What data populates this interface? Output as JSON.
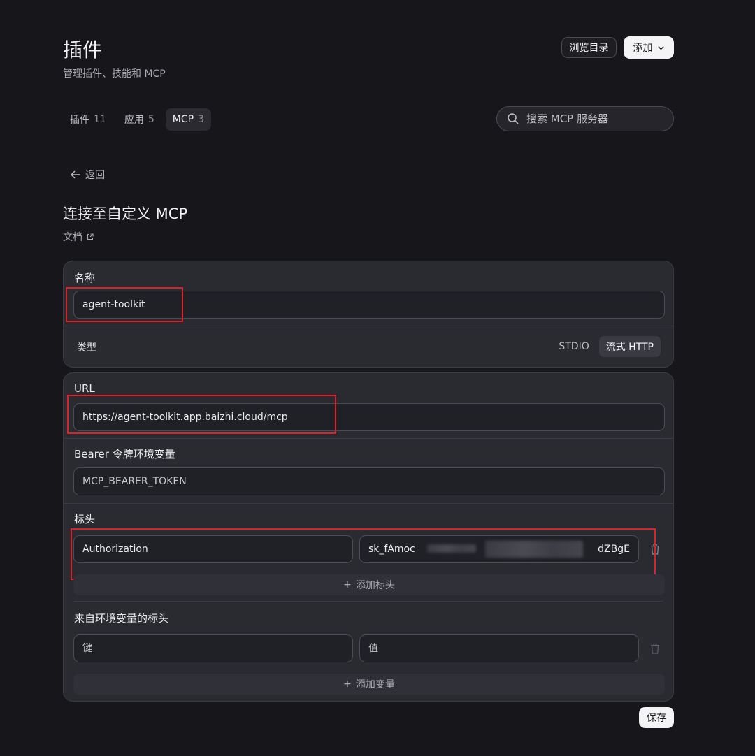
{
  "header": {
    "title": "插件",
    "subtitle": "管理插件、技能和 MCP",
    "browse_label": "浏览目录",
    "add_label": "添加"
  },
  "tabs": [
    {
      "label": "插件",
      "count": "11"
    },
    {
      "label": "应用",
      "count": "5"
    },
    {
      "label": "MCP",
      "count": "3"
    }
  ],
  "search": {
    "placeholder": "搜索 MCP 服务器"
  },
  "nav": {
    "back_label": "返回"
  },
  "form": {
    "title": "连接至自定义 MCP",
    "docs_label": "文档",
    "name": {
      "label": "名称",
      "value": "agent-toolkit"
    },
    "type": {
      "label": "类型",
      "options": [
        "STDIO",
        "流式 HTTP"
      ],
      "selected": "流式 HTTP"
    },
    "url": {
      "label": "URL",
      "value": "https://agent-toolkit.app.baizhi.cloud/mcp"
    },
    "bearer": {
      "label": "Bearer 令牌环境变量",
      "placeholder": "MCP_BEARER_TOKEN"
    },
    "headers": {
      "label": "标头",
      "rows": [
        {
          "key": "Authorization",
          "value_start": "sk_fAmoc",
          "value_end": "dZBgE"
        }
      ],
      "add_label": "添加标头"
    },
    "env_headers": {
      "label": "来自环境变量的标头",
      "key_placeholder": "键",
      "value_placeholder": "值",
      "add_label": "添加变量"
    },
    "save_label": "保存"
  },
  "colors": {
    "highlight": "#d8232a",
    "background": "#17171b",
    "card": "#2a2b31"
  }
}
